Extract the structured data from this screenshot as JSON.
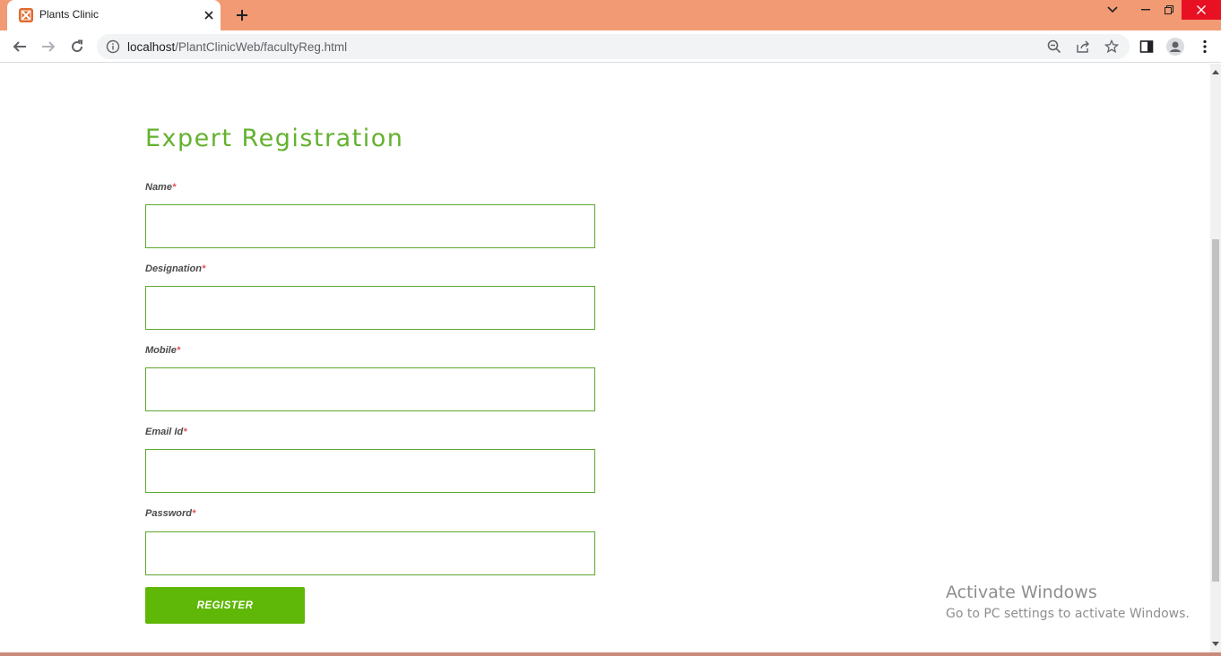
{
  "browser": {
    "tab_title": "Plants Clinic",
    "url_host": "localhost",
    "url_path": "/PlantClinicWeb/facultyReg.html",
    "accent_color": "#f29a73"
  },
  "form": {
    "title": "Expert Registration",
    "required_marker": "*",
    "fields": [
      {
        "label": "Name",
        "value": ""
      },
      {
        "label": "Designation",
        "value": ""
      },
      {
        "label": "Mobile",
        "value": ""
      },
      {
        "label": "Email Id",
        "value": ""
      },
      {
        "label": "Password",
        "value": ""
      }
    ],
    "submit_label": "REGISTER",
    "title_color": "#63b22e",
    "button_color": "#5fb708"
  },
  "watermark": {
    "title": "Activate Windows",
    "subtitle": "Go to PC settings to activate Windows."
  }
}
